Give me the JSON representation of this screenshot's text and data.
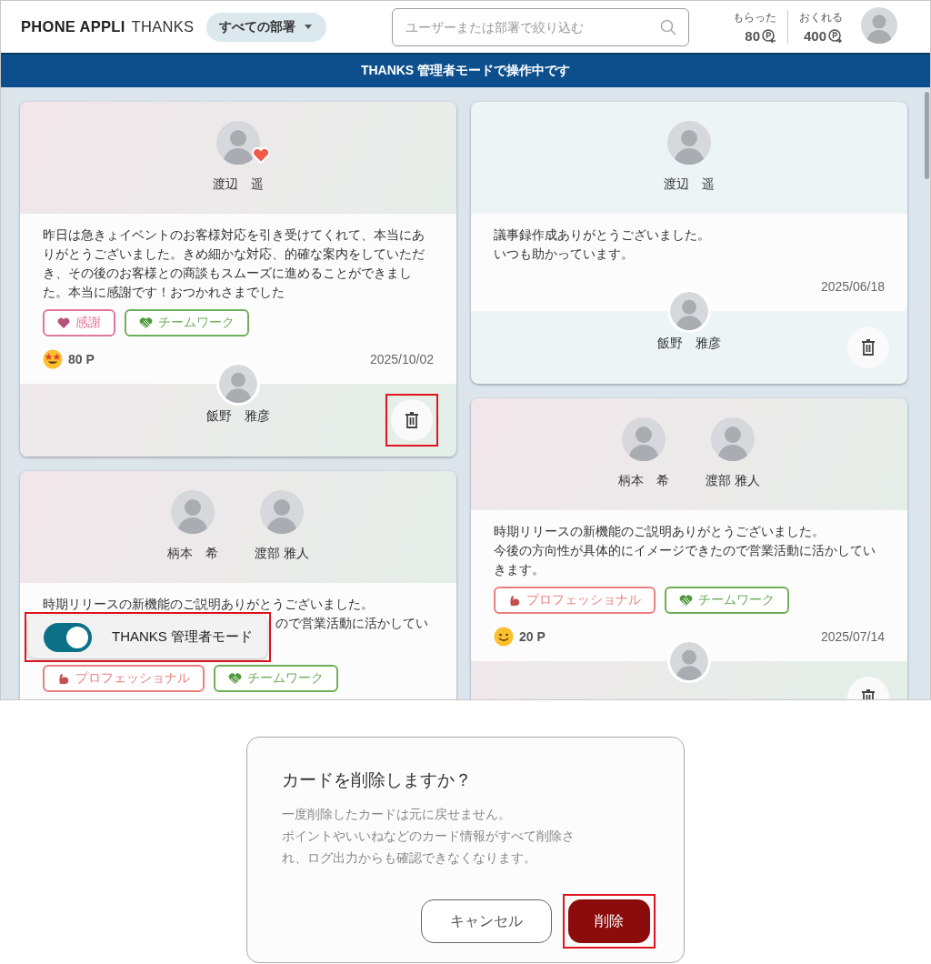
{
  "header": {
    "logo": {
      "brand": "PHONE APPLI",
      "product": "THANKS"
    },
    "department_filter": "すべての部署",
    "search": {
      "placeholder": "ユーザーまたは部署で絞り込む"
    },
    "points": [
      {
        "kind": "received",
        "label": "もらった",
        "value": "80"
      },
      {
        "kind": "giveable",
        "label": "おくれる",
        "value": "400"
      }
    ]
  },
  "admin_banner": "THANKS 管理者モードで操作中です",
  "columns": [
    [
      {
        "recipients": [
          {
            "name": "渡辺　遥",
            "reaction_badge": true
          }
        ],
        "message": [
          "昨日は急きょイベントのお客様対応を引き受けてくれて、本当にありがとうございました。きめ細かな対応、的確な案内をしていただき、その後のお客様との商談もスムーズに進めることができました。本当に感謝です！おつかれさまでした"
        ],
        "tags": [
          {
            "kind": "thanks",
            "label": "感謝",
            "color": "#e2779c"
          },
          {
            "kind": "teamwork",
            "label": "チームワーク",
            "color": "#6fae5a"
          }
        ],
        "reaction": {
          "kind": "starstruck",
          "points": "80 P"
        },
        "date": "2025/10/02",
        "sender": {
          "name": "飯野　雅彦"
        },
        "delete_button": {
          "highlighted": true
        }
      },
      {
        "recipients": [
          {
            "name": "柄本　希",
            "reaction_badge": false
          },
          {
            "name": "渡部 雅人",
            "reaction_badge": false
          }
        ],
        "message": [
          "時期リリースの新機能のご説明ありがとうございました。"
        ],
        "message_visible_fragment": "ので営業活動に活かしてい",
        "tags": [
          {
            "kind": "professional",
            "label": "プロフェッショナル",
            "color": "#ea7f7f"
          },
          {
            "kind": "teamwork",
            "label": "チームワーク",
            "color": "#6fae5a"
          }
        ]
      }
    ],
    [
      {
        "recipients": [
          {
            "name": "渡辺　遥",
            "reaction_badge": false
          }
        ],
        "message": [
          "議事録作成ありがとうございました。",
          "いつも助かっています。"
        ],
        "date": "2025/06/18",
        "sender": {
          "name": "飯野　雅彦"
        },
        "delete_button": {
          "highlighted": false
        }
      },
      {
        "recipients": [
          {
            "name": "柄本　希",
            "reaction_badge": false
          },
          {
            "name": "渡部 雅人",
            "reaction_badge": false
          }
        ],
        "message": [
          "時期リリースの新機能のご説明ありがとうございました。",
          "今後の方向性が具体的にイメージできたので営業活動に活かしていきます。"
        ],
        "tags": [
          {
            "kind": "professional",
            "label": "プロフェッショナル",
            "color": "#ea7f7f"
          },
          {
            "kind": "teamwork",
            "label": "チームワーク",
            "color": "#6fae5a"
          }
        ],
        "reaction": {
          "kind": "smiling",
          "points": "20 P"
        },
        "date": "2025/07/14",
        "delete_button": {
          "highlighted": false
        }
      }
    ]
  ],
  "admin_toggle": {
    "label": "THANKS 管理者モード",
    "on": true,
    "highlighted": true
  },
  "confirm_dialog": {
    "title": "カードを削除しますか？",
    "body": [
      "一度削除したカードは元に戻せません。",
      "ポイントやいいねなどのカード情報がすべて削除され、ログ出力からも確認できなくなります。"
    ],
    "buttons": [
      {
        "kind": "cancel",
        "label": "キャンセル",
        "highlighted": false
      },
      {
        "kind": "danger",
        "label": "削除",
        "highlighted": true
      }
    ]
  }
}
